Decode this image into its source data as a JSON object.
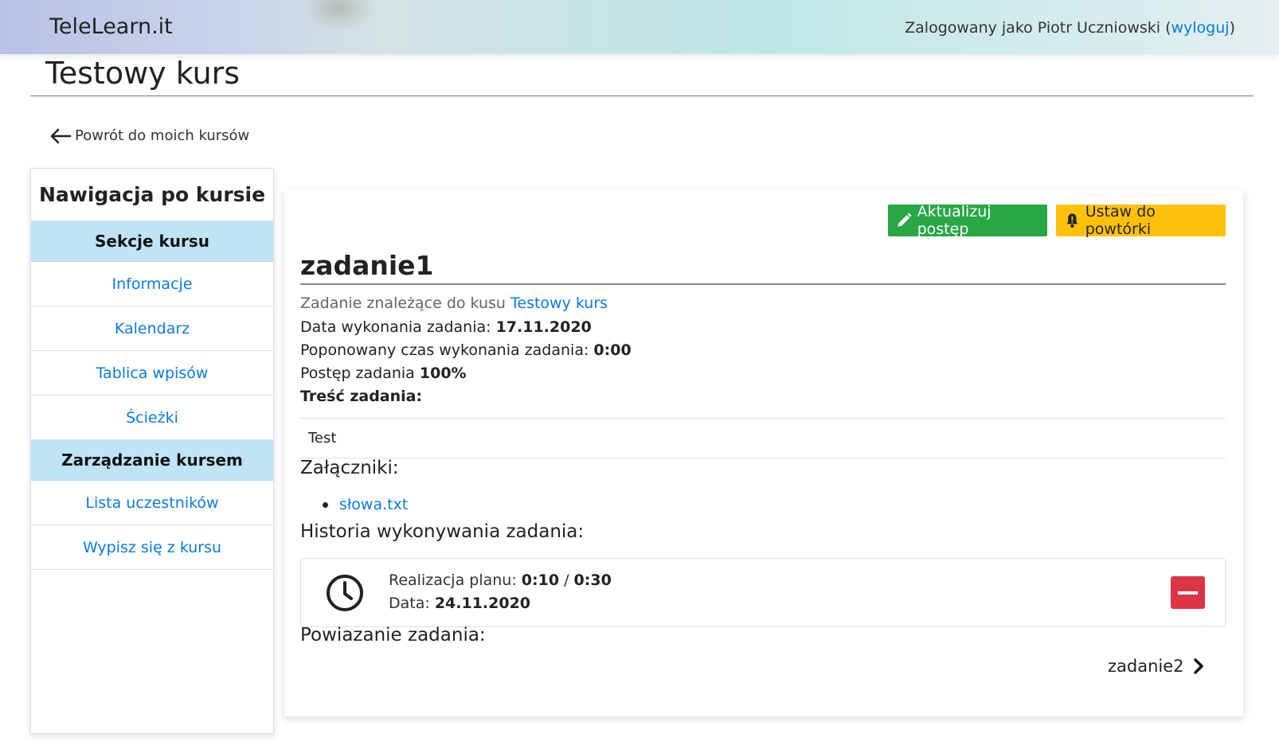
{
  "header": {
    "brand": "TeleLearn.it",
    "login_prefix": "Zalogowany jako Piotr Uczniowski (",
    "logout": "wyloguj",
    "login_suffix": ")"
  },
  "course": {
    "title": "Testowy kurs",
    "back_label": "Powrót do moich kursów"
  },
  "sidebar": {
    "title": "Nawigacja po kursie",
    "section1": "Sekcje kursu",
    "items1": [
      "Informacje",
      "Kalendarz",
      "Tablica wpisów",
      "Ścieżki"
    ],
    "section2": "Zarządzanie kursem",
    "items2": [
      "Lista uczestników",
      "Wypisz się z kursu"
    ]
  },
  "task": {
    "update_button": "Aktualizuj postęp",
    "review_button": "Ustaw do powtórki",
    "title": "zadanie1",
    "subtitle_prefix": "Zadanie znależące do kusu ",
    "subtitle_link": "Testowy kurs",
    "date_label": "Data wykonania zadania: ",
    "date_value": "17.11.2020",
    "time_label": "Poponowany czas wykonania zadania: ",
    "time_value": "0:00",
    "progress_label": "Postęp zadania ",
    "progress_value": "100%",
    "content_label": "Treść zadania:",
    "content_value": "Test",
    "attachments_heading": "Załączniki:",
    "attachments": [
      "słowa.txt"
    ],
    "history_heading": "Historia wykonywania zadania:",
    "history": {
      "plan_label": "Realizacja planu: ",
      "plan_done": "0:10",
      "plan_sep": " / ",
      "plan_total": "0:30",
      "date_label": "Data: ",
      "date_value": "24.11.2020"
    },
    "links_heading": "Powiazanie zadania:",
    "next_task": "zadanie2"
  },
  "colors": {
    "success": "#28a745",
    "warning": "#ffc107",
    "danger": "#dc3545",
    "link": "#0a7be0",
    "sidebar_section": "#bee5f7"
  }
}
